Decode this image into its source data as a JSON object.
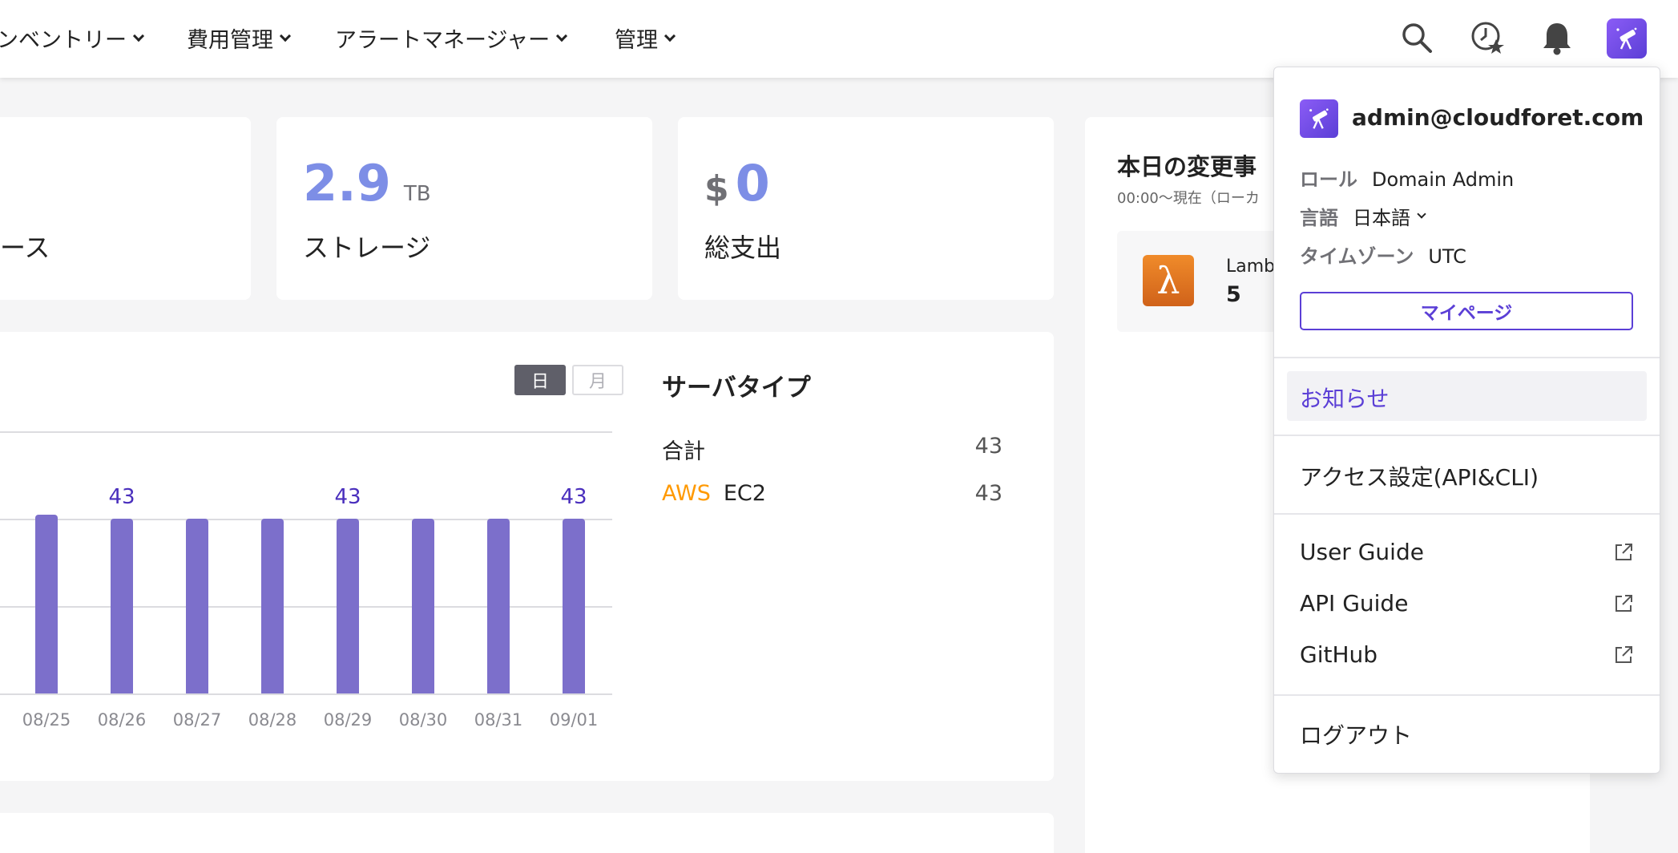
{
  "nav": {
    "items": [
      {
        "label": "ンベントリー"
      },
      {
        "label": "費用管理"
      },
      {
        "label": "アラートマネージャー"
      },
      {
        "label": "管理"
      }
    ],
    "icons": [
      "search-icon",
      "recent-favorite-icon",
      "bell-icon",
      "telescope-avatar-icon"
    ]
  },
  "summary_cards": [
    {
      "label": "ース"
    },
    {
      "value": "2.9",
      "unit": "TB",
      "label": "ストレージ"
    },
    {
      "currency": "$",
      "value": "0",
      "label": "総支出"
    }
  ],
  "chart": {
    "toggle": {
      "day": "日",
      "month": "月",
      "selected": "日"
    },
    "bar_color": "#7c6fcb"
  },
  "chart_data": {
    "type": "bar",
    "categories": [
      "08/25",
      "08/26",
      "08/27",
      "08/28",
      "08/29",
      "08/30",
      "08/31",
      "09/01"
    ],
    "values": [
      44,
      43,
      43,
      43,
      43,
      43,
      43,
      43
    ],
    "data_labels": [
      "",
      "43",
      "",
      "",
      "43",
      "",
      "",
      "43"
    ],
    "ylim": [
      0,
      66
    ],
    "grid": true
  },
  "server_type": {
    "title": "サーバタイプ",
    "total_label": "合計",
    "total_value": "43",
    "rows": [
      {
        "provider": "AWS",
        "type": "EC2",
        "count": "43"
      }
    ],
    "provider_color": "#ff9900"
  },
  "changes": {
    "title": "本日の変更事",
    "subtitle": "00:00〜現在（ローカ",
    "item": {
      "name": "Lamb",
      "count": "5"
    }
  },
  "profile": {
    "email": "admin@cloudforet.com",
    "role_label": "ロール",
    "role_value": "Domain Admin",
    "language_label": "言語",
    "language_value": "日本語",
    "timezone_label": "タイムゾーン",
    "timezone_value": "UTC",
    "mypage_button": "マイページ",
    "notice": "お知らせ",
    "access": "アクセス設定(API&CLI)",
    "links": [
      {
        "label": "User Guide"
      },
      {
        "label": "API Guide"
      },
      {
        "label": "GitHub"
      }
    ],
    "logout": "ログアウト",
    "accent_color": "#5b3fd6"
  }
}
